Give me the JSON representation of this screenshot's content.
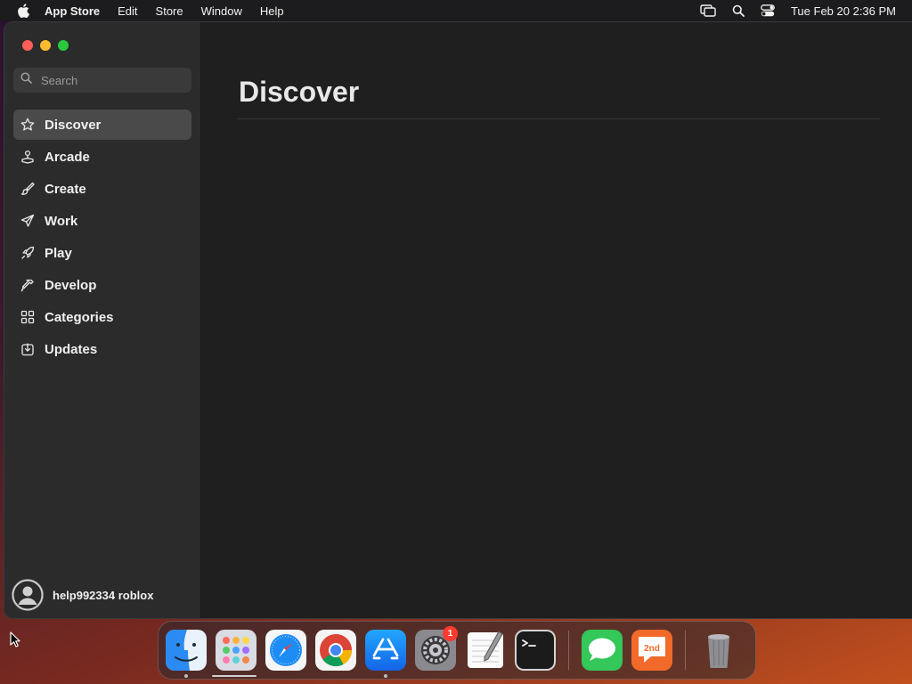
{
  "menubar": {
    "app_name": "App Store",
    "items": [
      "Edit",
      "Store",
      "Window",
      "Help"
    ],
    "clock": "Tue Feb 20  2:36 PM"
  },
  "sidebar": {
    "search": {
      "placeholder": "Search",
      "value": ""
    },
    "items": [
      {
        "label": "Discover",
        "icon": "star-icon",
        "active": true
      },
      {
        "label": "Arcade",
        "icon": "joystick-icon"
      },
      {
        "label": "Create",
        "icon": "brush-icon"
      },
      {
        "label": "Work",
        "icon": "paper-plane-icon"
      },
      {
        "label": "Play",
        "icon": "rocket-icon"
      },
      {
        "label": "Develop",
        "icon": "hammer-icon"
      },
      {
        "label": "Categories",
        "icon": "grid-icon"
      },
      {
        "label": "Updates",
        "icon": "download-icon"
      }
    ],
    "account": {
      "name": "help992334 roblox"
    }
  },
  "main": {
    "title": "Discover"
  },
  "dock": {
    "items": [
      {
        "name": "Finder",
        "running": true
      },
      {
        "name": "Launchpad"
      },
      {
        "name": "Safari"
      },
      {
        "name": "Chrome"
      },
      {
        "name": "App Store",
        "running": true
      },
      {
        "name": "System Settings",
        "badge": "1"
      },
      {
        "name": "TextEdit"
      },
      {
        "name": "Terminal"
      },
      {
        "name": "Messages"
      },
      {
        "name": "2nd",
        "label": "2nd"
      },
      {
        "name": "Trash"
      }
    ]
  },
  "colors": {
    "accent_close": "#ff5f57",
    "accent_minimize": "#febc2e",
    "accent_maximize": "#28c840",
    "badge": "#ff3b30"
  }
}
